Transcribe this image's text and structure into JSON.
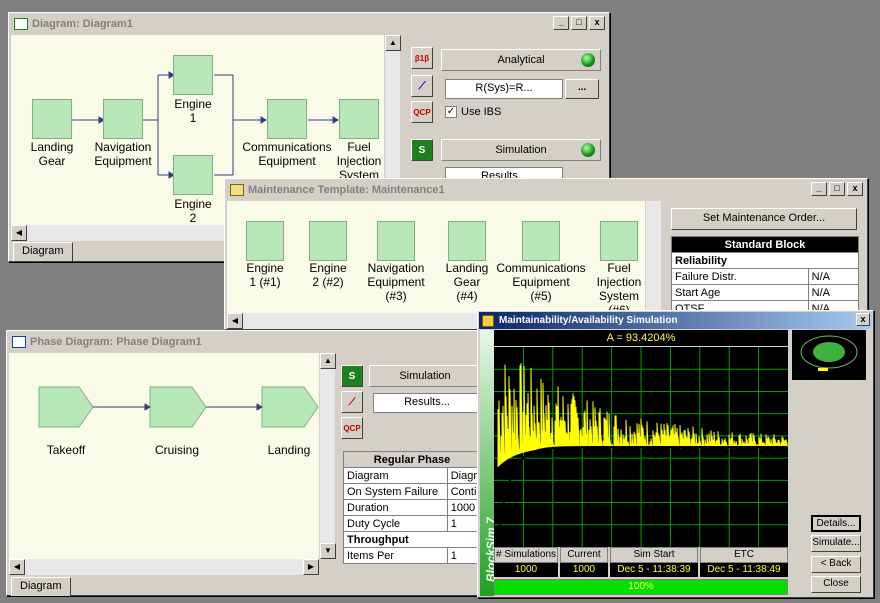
{
  "diagram_window": {
    "title": "Diagram: Diagram1",
    "blocks": [
      "Landing\nGear",
      "Navigation\nEquipment",
      "Engine\n1",
      "Engine\n2",
      "Communications\nEquipment",
      "Fuel\nInjection\nSystem"
    ],
    "analytical_label": "Analytical",
    "rsys_value": "R(Sys)=R...",
    "ellipsis": "...",
    "use_ibs_label": "Use IBS",
    "simulation_label": "Simulation",
    "results_label": "Results...",
    "tab_label": "Diagram"
  },
  "maintenance_window": {
    "title": "Maintenance Template: Maintenance1",
    "blocks": [
      "Engine\n1 (#1)",
      "Engine\n2 (#2)",
      "Navigation\nEquipment\n(#3)",
      "Landing\nGear\n(#4)",
      "Communications\nEquipment\n(#5)",
      "Fuel\nInjection\nSystem\n(#6)"
    ],
    "set_order_button": "Set Maintenance Order...",
    "table_header": "Standard Block",
    "reliability_label": "Reliability",
    "rows": [
      {
        "k": "Failure Distr.",
        "v": "N/A"
      },
      {
        "k": "Start Age",
        "v": "N/A"
      },
      {
        "k": "OTSF",
        "v": "N/A"
      }
    ]
  },
  "phase_window": {
    "title": "Phase Diagram: Phase Diagram1",
    "phases": [
      "Takeoff",
      "Cruising",
      "Landing"
    ],
    "simulation_label": "Simulation",
    "results_label": "Results...",
    "table_header": "Regular Phase",
    "rows": [
      {
        "k": "Diagram",
        "v": "Diagr"
      },
      {
        "k": "On System Failure",
        "v": "Conti"
      },
      {
        "k": "Duration",
        "v": "1000"
      },
      {
        "k": "Duty Cycle",
        "v": "1"
      }
    ],
    "throughput_label": "Throughput",
    "items_per_label": "Items Per",
    "items_per_value": "1",
    "tab_label": "Diagram"
  },
  "sim_window": {
    "title": "Maintainability/Availability Simulation",
    "availability": "A = 93.4204%",
    "side_label": "BlockSim 7",
    "headers": [
      "# Simulations",
      "Current",
      "Sim Start",
      "ETC"
    ],
    "values": [
      "1000",
      "1000",
      "Dec 5 - 11:38:39",
      "Dec 5 - 11:38:49"
    ],
    "progress_text": "100%",
    "progress_value": 1.0,
    "buttons": [
      "Details...",
      "Simulate...",
      "< Back",
      "Close"
    ],
    "close_glyph": "x"
  },
  "icons": {
    "minimize": "_",
    "maximize": "□",
    "close": "x",
    "scroll_up": "▲",
    "scroll_down": "▼",
    "scroll_left": "◀",
    "scroll_right": "▶",
    "s_icon": "S",
    "qcp_icon": "QCP"
  },
  "colors": {
    "block_fill": "#b8e8b8",
    "canvas": "#fafae8",
    "sim_bg": "#000000",
    "grid": "#00c000",
    "trace": "#ffff00"
  }
}
